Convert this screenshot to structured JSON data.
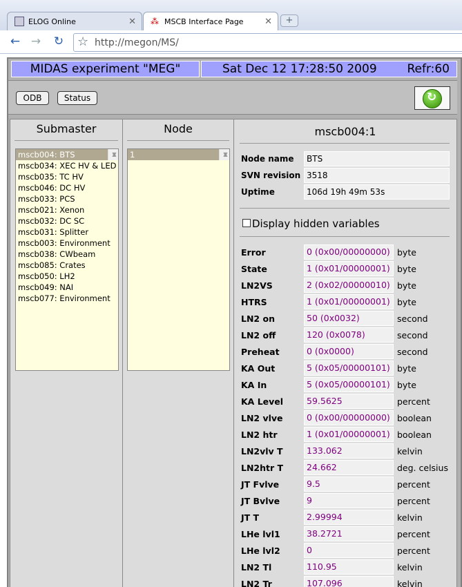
{
  "browser": {
    "tabs": [
      {
        "label": "ELOG Online"
      },
      {
        "label": "MSCB Interface Page"
      }
    ],
    "newtab": "+",
    "url": "http://megon/MS/"
  },
  "header": {
    "title": "MIDAS experiment \"MEG\"",
    "datetime": "Sat Dec 12 17:28:50 2009",
    "refresh": "Refr:60"
  },
  "buttons": {
    "odb": "ODB",
    "status": "Status"
  },
  "submaster": {
    "heading": "Submaster",
    "items": [
      "mscb004: BTS",
      "mscb034: XEC HV & LED",
      "mscb035: TC HV",
      "mscb046: DC HV",
      "mscb033: PCS",
      "mscb021: Xenon",
      "mscb032: DC SC",
      "mscb031: Splitter",
      "mscb003: Environment",
      "mscb038: CWbeam",
      "mscb085: Crates",
      "mscb050: LH2",
      "mscb049: NAI",
      "mscb077: Environment"
    ]
  },
  "node": {
    "heading": "Node",
    "items": [
      "1"
    ]
  },
  "detail": {
    "title": "mscb004:1",
    "info": [
      {
        "label": "Node name",
        "value": "BTS"
      },
      {
        "label": "SVN revision",
        "value": "3518"
      },
      {
        "label": "Uptime",
        "value": "106d 19h 49m 53s"
      }
    ],
    "hidden_label": "Display hidden variables",
    "variables": [
      {
        "name": "Error",
        "value": "0 (0x00/00000000)",
        "unit": "byte"
      },
      {
        "name": "State",
        "value": "1 (0x01/00000001)",
        "unit": "byte"
      },
      {
        "name": "LN2VS",
        "value": "2 (0x02/00000010)",
        "unit": "byte"
      },
      {
        "name": "HTRS",
        "value": "1 (0x01/00000001)",
        "unit": "byte"
      },
      {
        "name": "LN2 on",
        "value": "50 (0x0032)",
        "unit": "second"
      },
      {
        "name": "LN2 off",
        "value": "120 (0x0078)",
        "unit": "second"
      },
      {
        "name": "Preheat",
        "value": "0 (0x0000)",
        "unit": "second"
      },
      {
        "name": "KA Out",
        "value": "5 (0x05/00000101)",
        "unit": "byte"
      },
      {
        "name": "KA In",
        "value": "5 (0x05/00000101)",
        "unit": "byte"
      },
      {
        "name": "KA Level",
        "value": "59.5625",
        "unit": "percent"
      },
      {
        "name": "LN2 vlve",
        "value": "0 (0x00/00000000)",
        "unit": "boolean"
      },
      {
        "name": "LN2 htr",
        "value": "1 (0x01/00000001)",
        "unit": "boolean"
      },
      {
        "name": "LN2vlv T",
        "value": "133.062",
        "unit": "kelvin"
      },
      {
        "name": "LN2htr T",
        "value": "24.662",
        "unit": "deg. celsius"
      },
      {
        "name": "JT Fvlve",
        "value": "9.5",
        "unit": "percent"
      },
      {
        "name": "JT Bvlve",
        "value": "9",
        "unit": "percent"
      },
      {
        "name": "JT T",
        "value": "2.99994",
        "unit": "kelvin"
      },
      {
        "name": "LHe lvl1",
        "value": "38.2721",
        "unit": "percent"
      },
      {
        "name": "LHe lvl2",
        "value": "0",
        "unit": "percent"
      },
      {
        "name": "LN2 Tl",
        "value": "110.95",
        "unit": "kelvin"
      },
      {
        "name": "LN2 Tr",
        "value": "107.096",
        "unit": "kelvin"
      }
    ]
  },
  "colors": {
    "title_bg": "#a0a0ff",
    "panel_bg": "#dcdcdc",
    "list_bg": "#ffffe0",
    "selected_bg": "#b0a890",
    "value_text": "#800080"
  }
}
